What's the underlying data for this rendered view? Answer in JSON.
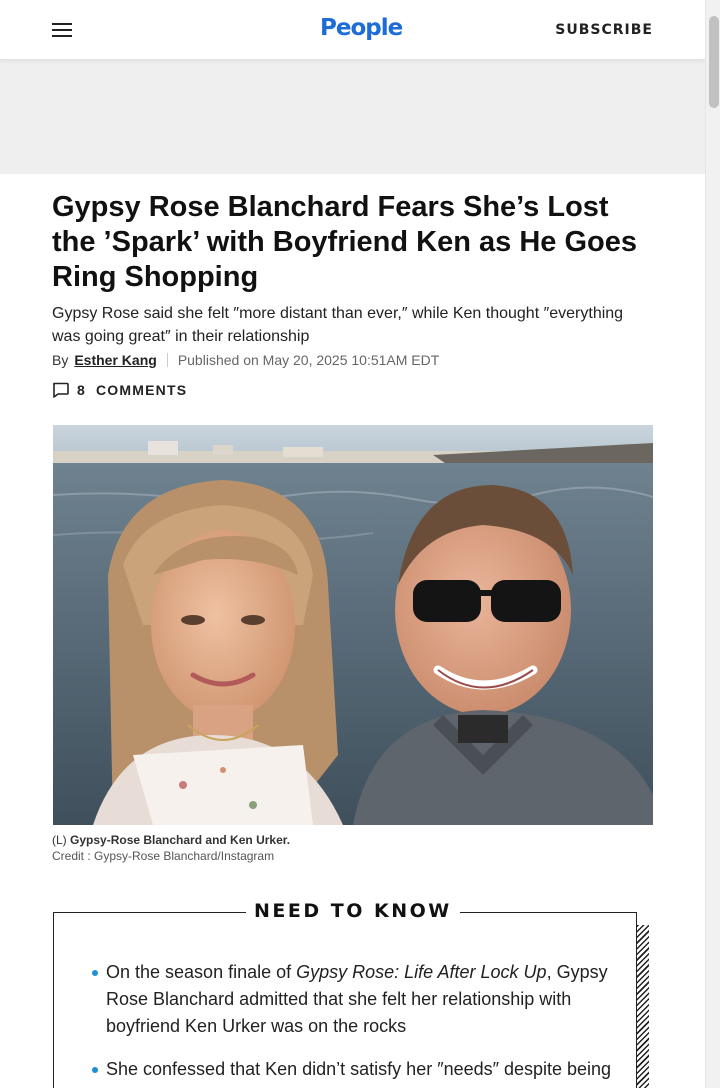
{
  "header": {
    "logo_text": "People",
    "subscribe_label": "SUBSCRIBE",
    "menu_icon": "hamburger-menu-icon",
    "brand_color": "#1d6cd8"
  },
  "article": {
    "headline": "Gypsy Rose Blanchard Fears She’s Lost the ’Spark’ with Boyfriend Ken as He Goes Ring Shopping",
    "dek": "Gypsy Rose said she felt ″more distant than ever,″ while Ken thought ″everything was going great″ in their relationship",
    "byline_prefix": "By",
    "author": "Esther Kang",
    "published": "Published on May 20, 2025 10:51AM EDT",
    "comments_count": "8",
    "comments_label": "COMMENTS",
    "comments_icon": "comment-bubble-icon"
  },
  "photo": {
    "caption_prefix": "(L)",
    "caption": "Gypsy-Rose Blanchard and Ken Urker.",
    "credit": "Credit : Gypsy-Rose Blanchard/Instagram"
  },
  "need_to_know": {
    "title": "NEED TO KNOW",
    "bullet_color": "#1d8fd6",
    "items": [
      {
        "before": "On the season finale of ",
        "italic": "Gypsy Rose: Life After Lock Up",
        "after": ", Gypsy Rose Blanchard admitted that she felt her relationship with boyfriend Ken Urker was on the rocks"
      },
      {
        "before": "She confessed that Ken didn’t satisfy her ″needs″ despite being patient and understanding of all she has suffered",
        "italic": "",
        "after": ""
      }
    ]
  }
}
